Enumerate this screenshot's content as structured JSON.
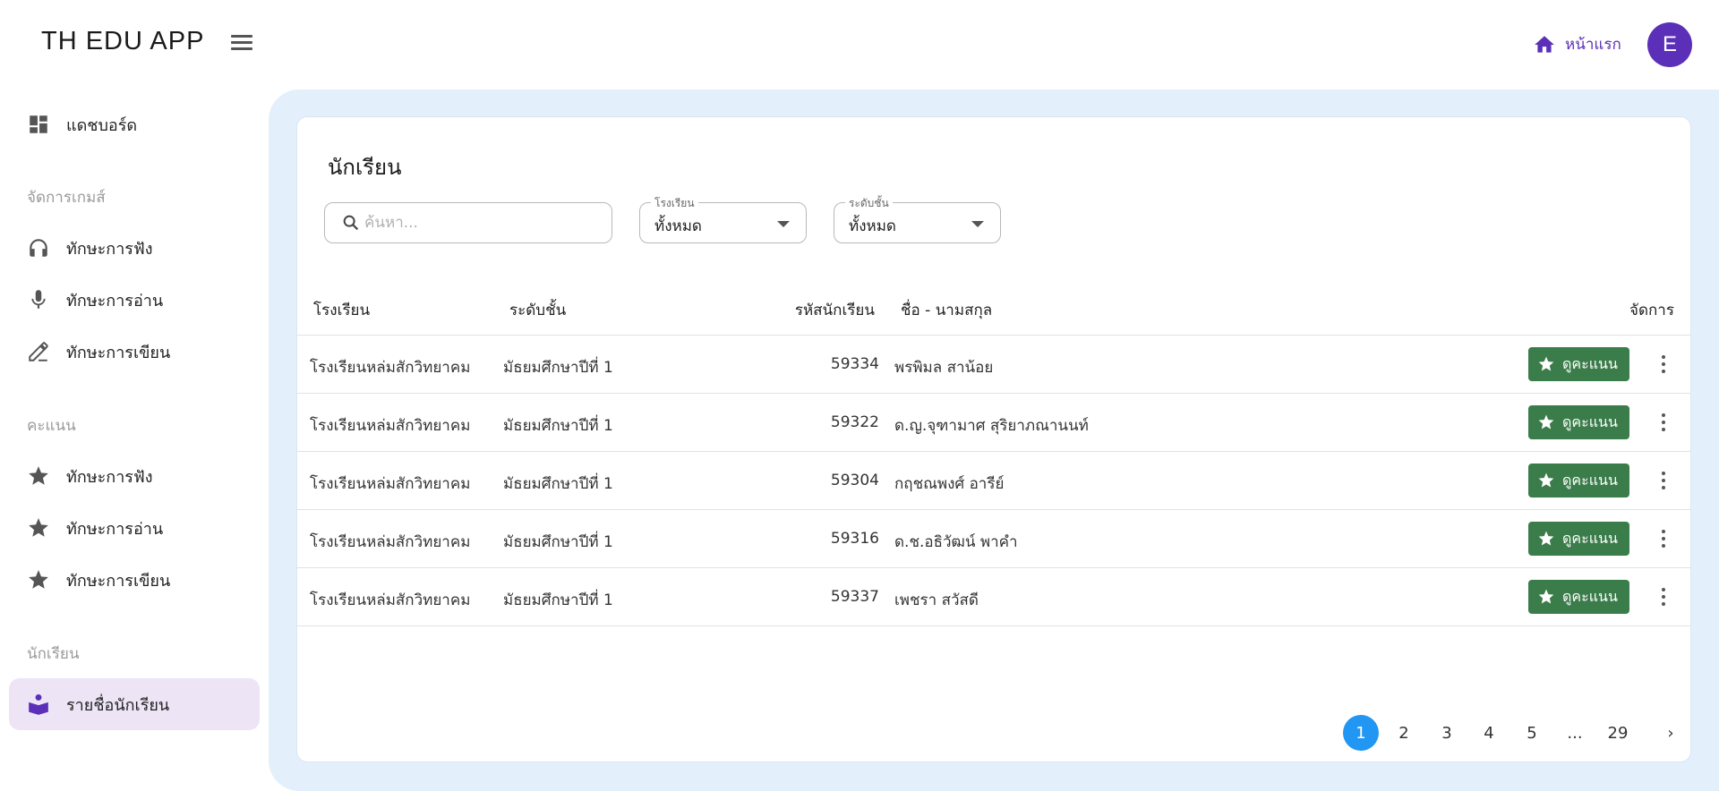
{
  "app": {
    "title": "TH EDU APP"
  },
  "header": {
    "home_label": "หน้าแรก",
    "avatar_letter": "E"
  },
  "sidebar": {
    "dashboard": {
      "label": "แดชบอร์ด",
      "icon": "dashboard-icon"
    },
    "sections": [
      {
        "title": "จัดการเกมส์",
        "items": [
          {
            "label": "ทักษะการฟัง",
            "icon": "headphones-icon"
          },
          {
            "label": "ทักษะการอ่าน",
            "icon": "microphone-icon"
          },
          {
            "label": "ทักษะการเขียน",
            "icon": "pen-icon"
          }
        ]
      },
      {
        "title": "คะแนน",
        "items": [
          {
            "label": "ทักษะการฟัง",
            "icon": "star-icon"
          },
          {
            "label": "ทักษะการอ่าน",
            "icon": "star-icon"
          },
          {
            "label": "ทักษะการเขียน",
            "icon": "star-icon"
          }
        ]
      },
      {
        "title": "นักเรียน",
        "items": [
          {
            "label": "รายชื่อนักเรียน",
            "icon": "student-book-icon",
            "active": true
          }
        ]
      }
    ]
  },
  "page": {
    "title": "นักเรียน",
    "search": {
      "placeholder": "ค้นหา...",
      "value": ""
    },
    "filters": {
      "school": {
        "label": "โรงเรียน",
        "value": "ทั้งหมด"
      },
      "level": {
        "label": "ระดับชั้น",
        "value": "ทั้งหมด"
      }
    },
    "table": {
      "columns": [
        "โรงเรียน",
        "ระดับชั้น",
        "รหัสนักเรียน",
        "ชื่อ - นามสกุล",
        "จัดการ"
      ],
      "action_label": "ดูคะแนน",
      "rows": [
        {
          "school": "โรงเรียนหล่มสักวิทยาคม",
          "level": "มัธยมศึกษาปีที่ 1",
          "id": "59334",
          "name": "พรพิมล สาน้อย"
        },
        {
          "school": "โรงเรียนหล่มสักวิทยาคม",
          "level": "มัธยมศึกษาปีที่ 1",
          "id": "59322",
          "name": "ด.ญ.จุฑามาศ สุริยาภณานนท์"
        },
        {
          "school": "โรงเรียนหล่มสักวิทยาคม",
          "level": "มัธยมศึกษาปีที่ 1",
          "id": "59304",
          "name": "กฤชณพงศ์ อารีย์"
        },
        {
          "school": "โรงเรียนหล่มสักวิทยาคม",
          "level": "มัธยมศึกษาปีที่ 1",
          "id": "59316",
          "name": "ด.ช.อธิวัฒน์ พาคำ"
        },
        {
          "school": "โรงเรียนหล่มสักวิทยาคม",
          "level": "มัธยมศึกษาปีที่ 1",
          "id": "59337",
          "name": "เพชรา สวัสดี"
        }
      ]
    },
    "pagination": {
      "pages": [
        "1",
        "2",
        "3",
        "4",
        "5",
        "...",
        "29"
      ],
      "current": "1"
    }
  },
  "colors": {
    "accent": "#5b2fb8",
    "score_button": "#3b7d4a",
    "page_active": "#2196f3",
    "main_bg": "#e3f0fb",
    "active_nav": "#ede4f6"
  }
}
